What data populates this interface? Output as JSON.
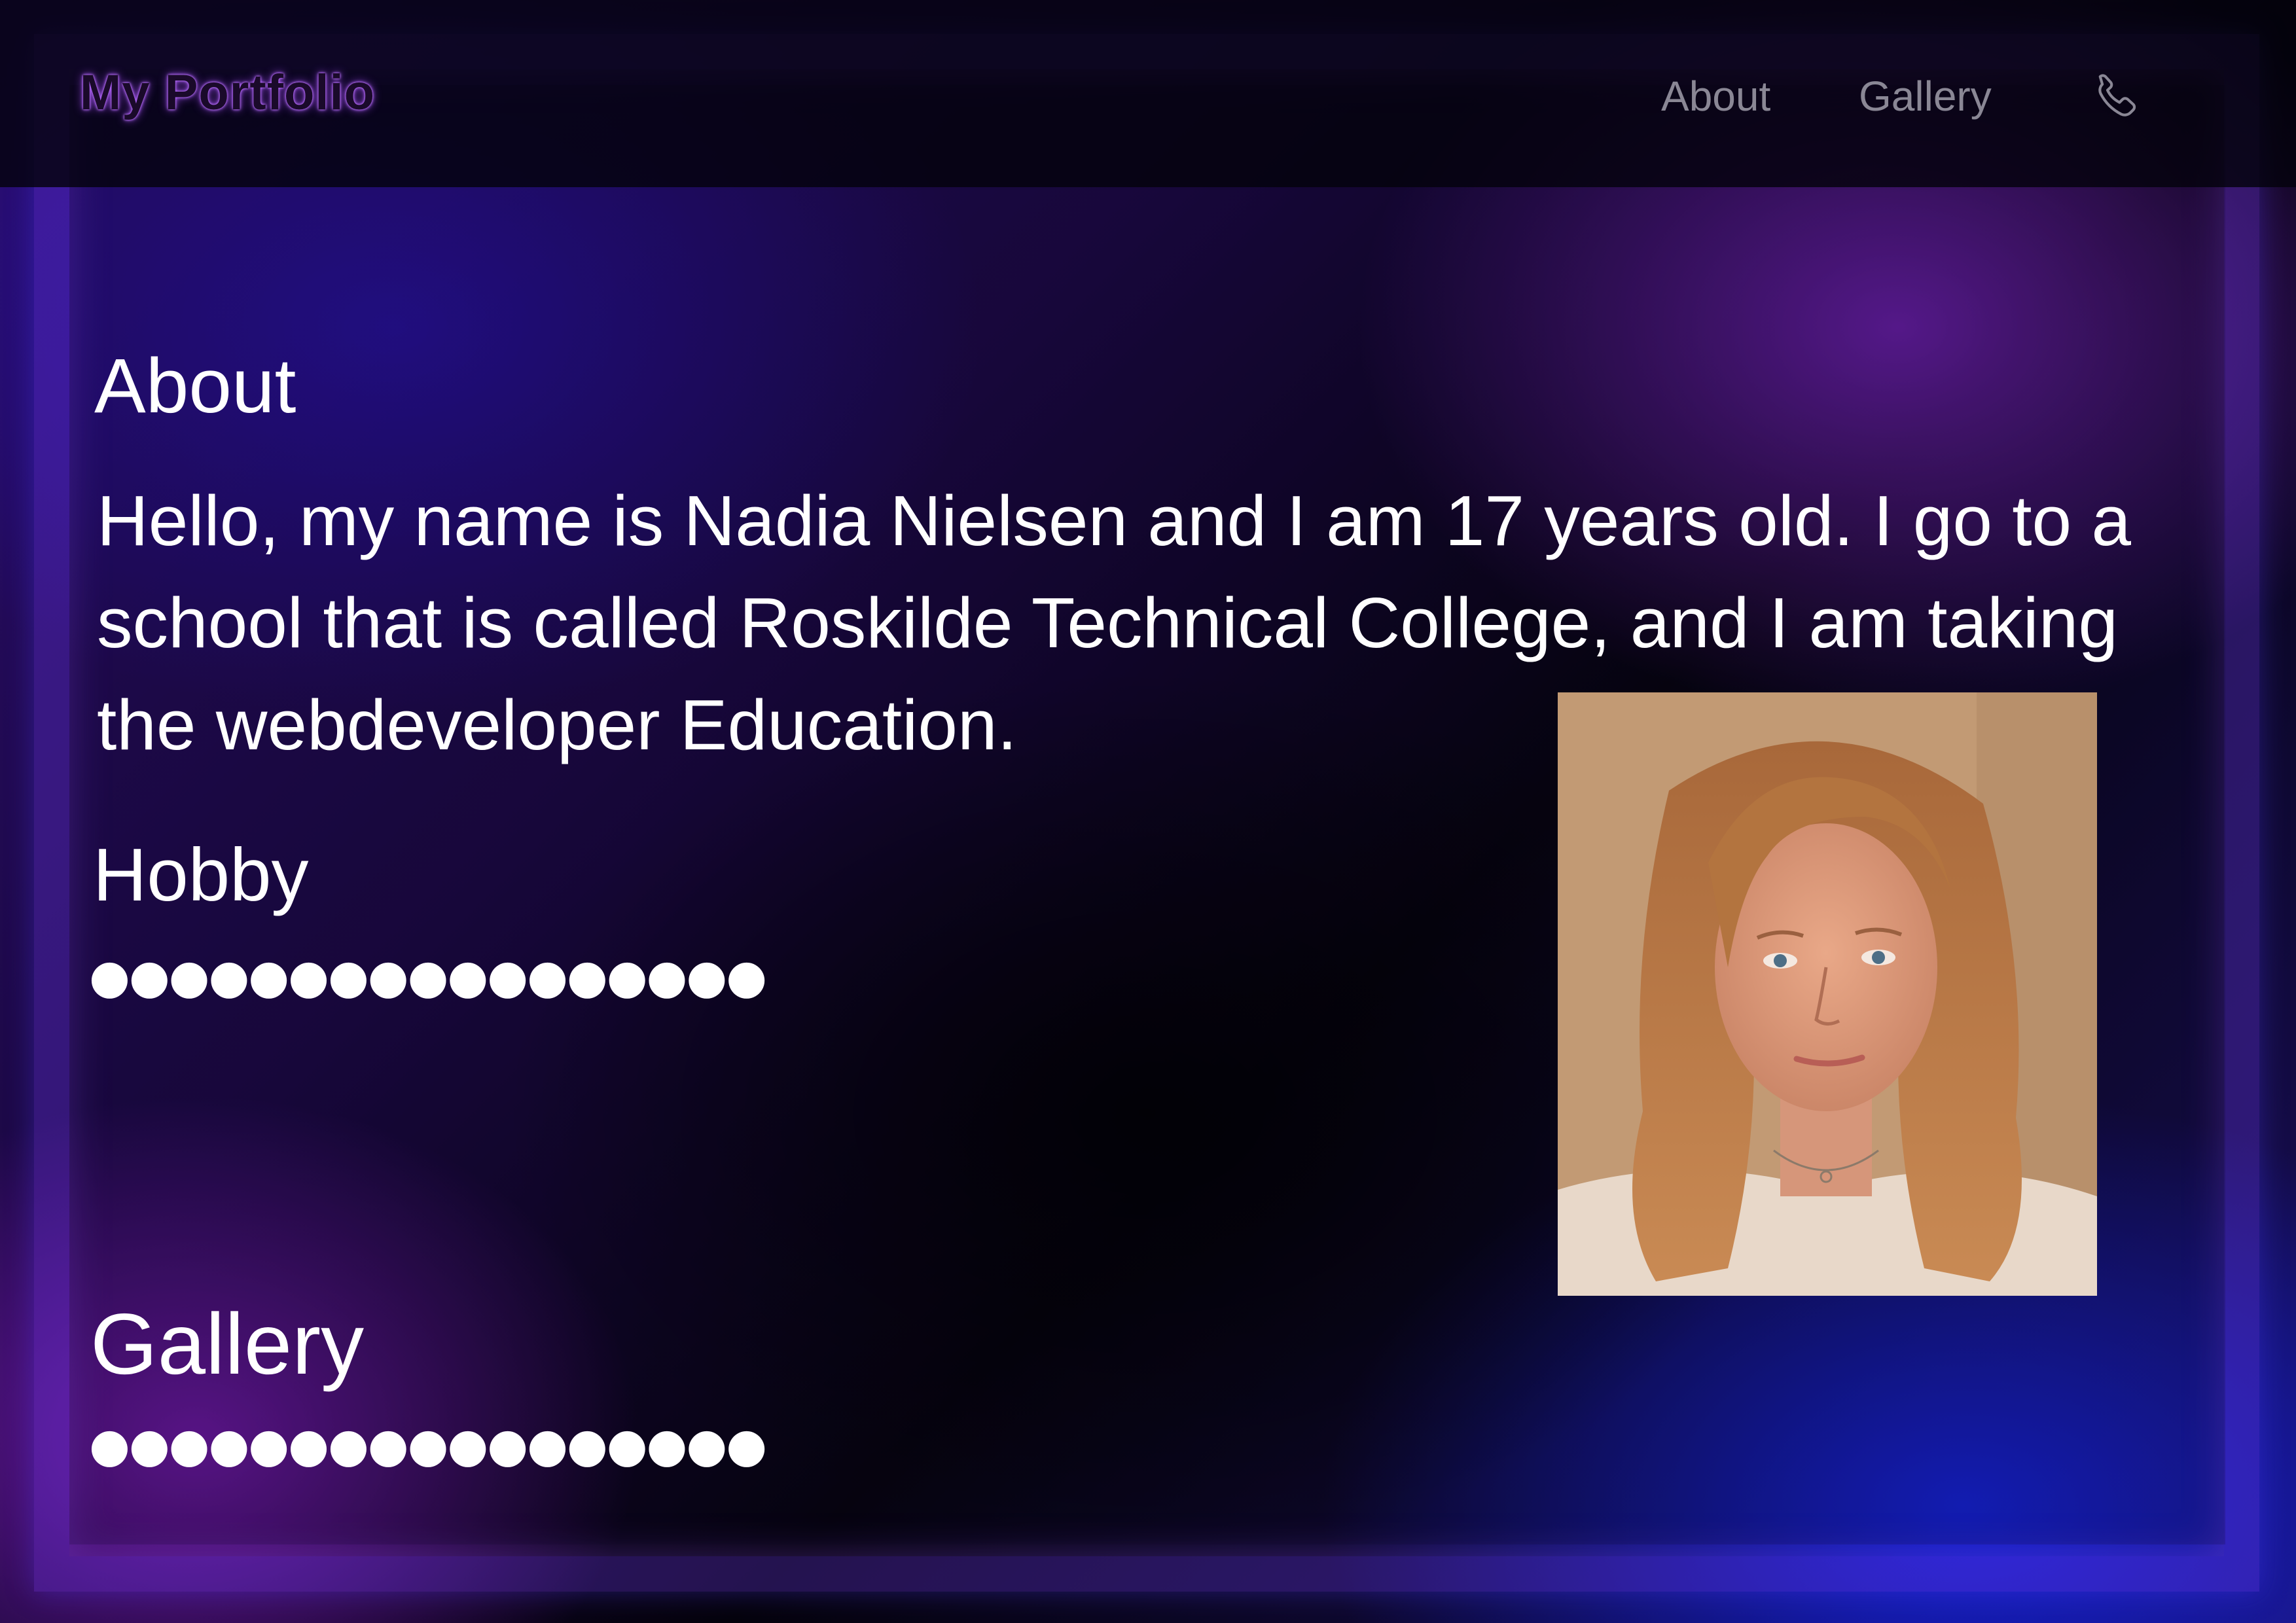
{
  "navbar": {
    "brand": "My Portfolio",
    "links": [
      {
        "label": "About"
      },
      {
        "label": "Gallery"
      }
    ],
    "phone_icon": "phone-icon"
  },
  "about": {
    "heading": "About",
    "intro": "Hello, my name is Nadia Nielsen and I am 17 years old. I go to a school that is called Roskilde Technical College, and I am taking the webdeveloper Education."
  },
  "hobby": {
    "heading": "Hobby",
    "dots": "●●●●●●●●●●●●●●●●●"
  },
  "gallery": {
    "heading": "Gallery",
    "dots": "●●●●●●●●●●●●●●●●●"
  },
  "photo": {
    "icon": "profile-photo"
  },
  "colors": {
    "brand_glow": "#b060ff",
    "nav_text": "#8a8795",
    "text": "#ffffff"
  }
}
